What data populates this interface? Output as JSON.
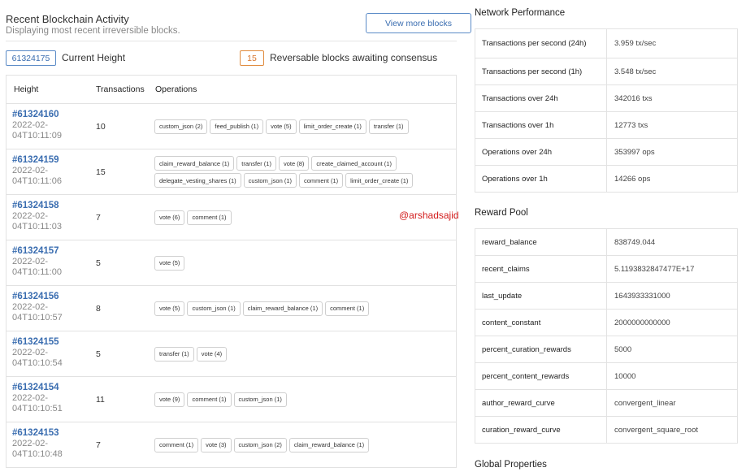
{
  "activity": {
    "title": "Recent Blockchain Activity",
    "subtitle": "Displaying most recent irreversible blocks.",
    "view_more_label": "View more blocks",
    "current_height_value": "61324175",
    "current_height_label": "Current Height",
    "reversible_count": "15",
    "reversible_label": "Reversable blocks awaiting consensus",
    "columns": [
      "Height",
      "Transactions",
      "Operations"
    ],
    "blocks": [
      {
        "height": "#61324160",
        "time": "2022-02-04T10:11:09",
        "txs": "10",
        "ops": [
          "custom_json (2)",
          "feed_publish (1)",
          "vote (5)",
          "limit_order_create (1)",
          "transfer (1)"
        ]
      },
      {
        "height": "#61324159",
        "time": "2022-02-04T10:11:06",
        "txs": "15",
        "ops": [
          "claim_reward_balance (1)",
          "transfer (1)",
          "vote (8)",
          "create_claimed_account (1)",
          "delegate_vesting_shares (1)",
          "custom_json (1)",
          "comment (1)",
          "limit_order_create (1)"
        ]
      },
      {
        "height": "#61324158",
        "time": "2022-02-04T10:11:03",
        "txs": "7",
        "ops": [
          "vote (6)",
          "comment (1)"
        ]
      },
      {
        "height": "#61324157",
        "time": "2022-02-04T10:11:00",
        "txs": "5",
        "ops": [
          "vote (5)"
        ]
      },
      {
        "height": "#61324156",
        "time": "2022-02-04T10:10:57",
        "txs": "8",
        "ops": [
          "vote (5)",
          "custom_json (1)",
          "claim_reward_balance (1)",
          "comment (1)"
        ]
      },
      {
        "height": "#61324155",
        "time": "2022-02-04T10:10:54",
        "txs": "5",
        "ops": [
          "transfer (1)",
          "vote (4)"
        ]
      },
      {
        "height": "#61324154",
        "time": "2022-02-04T10:10:51",
        "txs": "11",
        "ops": [
          "vote (9)",
          "comment (1)",
          "custom_json (1)"
        ]
      },
      {
        "height": "#61324153",
        "time": "2022-02-04T10:10:48",
        "txs": "7",
        "ops": [
          "comment (1)",
          "vote (3)",
          "custom_json (2)",
          "claim_reward_balance (1)"
        ]
      }
    ]
  },
  "watermark": "@arshadsajid",
  "network": {
    "title": "Network Performance",
    "rows": [
      {
        "k": "Transactions per second (24h)",
        "v": "3.959 tx/sec"
      },
      {
        "k": "Transactions per second (1h)",
        "v": "3.548 tx/sec"
      },
      {
        "k": "Transactions over 24h",
        "v": "342016 txs"
      },
      {
        "k": "Transactions over 1h",
        "v": "12773 txs"
      },
      {
        "k": "Operations over 24h",
        "v": "353997 ops"
      },
      {
        "k": "Operations over 1h",
        "v": "14266 ops"
      }
    ]
  },
  "reward_pool": {
    "title": "Reward Pool",
    "rows": [
      {
        "k": "reward_balance",
        "v": "838749.044"
      },
      {
        "k": "recent_claims",
        "v": "5.1193832847477E+17"
      },
      {
        "k": "last_update",
        "v": "1643933331000"
      },
      {
        "k": "content_constant",
        "v": "2000000000000"
      },
      {
        "k": "percent_curation_rewards",
        "v": "5000"
      },
      {
        "k": "percent_content_rewards",
        "v": "10000"
      },
      {
        "k": "author_reward_curve",
        "v": "convergent_linear"
      },
      {
        "k": "curation_reward_curve",
        "v": "convergent_square_root"
      }
    ]
  },
  "global": {
    "title": "Global Properties"
  }
}
